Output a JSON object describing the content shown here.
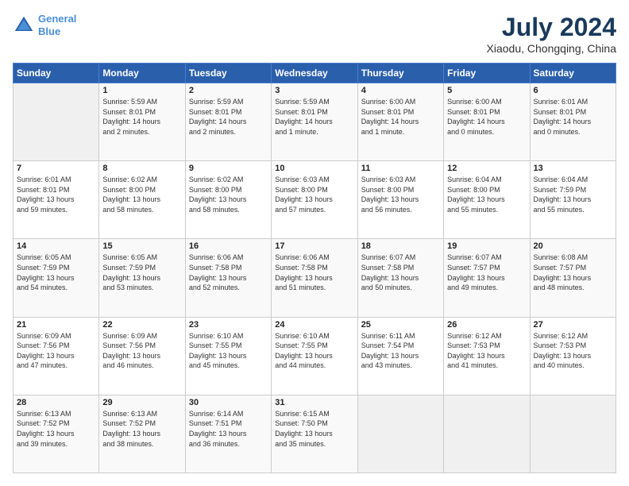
{
  "logo": {
    "line1": "General",
    "line2": "Blue"
  },
  "title": "July 2024",
  "subtitle": "Xiaodu, Chongqing, China",
  "header_days": [
    "Sunday",
    "Monday",
    "Tuesday",
    "Wednesday",
    "Thursday",
    "Friday",
    "Saturday"
  ],
  "weeks": [
    [
      {
        "day": "",
        "info": ""
      },
      {
        "day": "1",
        "info": "Sunrise: 5:59 AM\nSunset: 8:01 PM\nDaylight: 14 hours\nand 2 minutes."
      },
      {
        "day": "2",
        "info": "Sunrise: 5:59 AM\nSunset: 8:01 PM\nDaylight: 14 hours\nand 2 minutes."
      },
      {
        "day": "3",
        "info": "Sunrise: 5:59 AM\nSunset: 8:01 PM\nDaylight: 14 hours\nand 1 minute."
      },
      {
        "day": "4",
        "info": "Sunrise: 6:00 AM\nSunset: 8:01 PM\nDaylight: 14 hours\nand 1 minute."
      },
      {
        "day": "5",
        "info": "Sunrise: 6:00 AM\nSunset: 8:01 PM\nDaylight: 14 hours\nand 0 minutes."
      },
      {
        "day": "6",
        "info": "Sunrise: 6:01 AM\nSunset: 8:01 PM\nDaylight: 14 hours\nand 0 minutes."
      }
    ],
    [
      {
        "day": "7",
        "info": "Sunrise: 6:01 AM\nSunset: 8:01 PM\nDaylight: 13 hours\nand 59 minutes."
      },
      {
        "day": "8",
        "info": "Sunrise: 6:02 AM\nSunset: 8:00 PM\nDaylight: 13 hours\nand 58 minutes."
      },
      {
        "day": "9",
        "info": "Sunrise: 6:02 AM\nSunset: 8:00 PM\nDaylight: 13 hours\nand 58 minutes."
      },
      {
        "day": "10",
        "info": "Sunrise: 6:03 AM\nSunset: 8:00 PM\nDaylight: 13 hours\nand 57 minutes."
      },
      {
        "day": "11",
        "info": "Sunrise: 6:03 AM\nSunset: 8:00 PM\nDaylight: 13 hours\nand 56 minutes."
      },
      {
        "day": "12",
        "info": "Sunrise: 6:04 AM\nSunset: 8:00 PM\nDaylight: 13 hours\nand 55 minutes."
      },
      {
        "day": "13",
        "info": "Sunrise: 6:04 AM\nSunset: 7:59 PM\nDaylight: 13 hours\nand 55 minutes."
      }
    ],
    [
      {
        "day": "14",
        "info": "Sunrise: 6:05 AM\nSunset: 7:59 PM\nDaylight: 13 hours\nand 54 minutes."
      },
      {
        "day": "15",
        "info": "Sunrise: 6:05 AM\nSunset: 7:59 PM\nDaylight: 13 hours\nand 53 minutes."
      },
      {
        "day": "16",
        "info": "Sunrise: 6:06 AM\nSunset: 7:58 PM\nDaylight: 13 hours\nand 52 minutes."
      },
      {
        "day": "17",
        "info": "Sunrise: 6:06 AM\nSunset: 7:58 PM\nDaylight: 13 hours\nand 51 minutes."
      },
      {
        "day": "18",
        "info": "Sunrise: 6:07 AM\nSunset: 7:58 PM\nDaylight: 13 hours\nand 50 minutes."
      },
      {
        "day": "19",
        "info": "Sunrise: 6:07 AM\nSunset: 7:57 PM\nDaylight: 13 hours\nand 49 minutes."
      },
      {
        "day": "20",
        "info": "Sunrise: 6:08 AM\nSunset: 7:57 PM\nDaylight: 13 hours\nand 48 minutes."
      }
    ],
    [
      {
        "day": "21",
        "info": "Sunrise: 6:09 AM\nSunset: 7:56 PM\nDaylight: 13 hours\nand 47 minutes."
      },
      {
        "day": "22",
        "info": "Sunrise: 6:09 AM\nSunset: 7:56 PM\nDaylight: 13 hours\nand 46 minutes."
      },
      {
        "day": "23",
        "info": "Sunrise: 6:10 AM\nSunset: 7:55 PM\nDaylight: 13 hours\nand 45 minutes."
      },
      {
        "day": "24",
        "info": "Sunrise: 6:10 AM\nSunset: 7:55 PM\nDaylight: 13 hours\nand 44 minutes."
      },
      {
        "day": "25",
        "info": "Sunrise: 6:11 AM\nSunset: 7:54 PM\nDaylight: 13 hours\nand 43 minutes."
      },
      {
        "day": "26",
        "info": "Sunrise: 6:12 AM\nSunset: 7:53 PM\nDaylight: 13 hours\nand 41 minutes."
      },
      {
        "day": "27",
        "info": "Sunrise: 6:12 AM\nSunset: 7:53 PM\nDaylight: 13 hours\nand 40 minutes."
      }
    ],
    [
      {
        "day": "28",
        "info": "Sunrise: 6:13 AM\nSunset: 7:52 PM\nDaylight: 13 hours\nand 39 minutes."
      },
      {
        "day": "29",
        "info": "Sunrise: 6:13 AM\nSunset: 7:52 PM\nDaylight: 13 hours\nand 38 minutes."
      },
      {
        "day": "30",
        "info": "Sunrise: 6:14 AM\nSunset: 7:51 PM\nDaylight: 13 hours\nand 36 minutes."
      },
      {
        "day": "31",
        "info": "Sunrise: 6:15 AM\nSunset: 7:50 PM\nDaylight: 13 hours\nand 35 minutes."
      },
      {
        "day": "",
        "info": ""
      },
      {
        "day": "",
        "info": ""
      },
      {
        "day": "",
        "info": ""
      }
    ]
  ]
}
